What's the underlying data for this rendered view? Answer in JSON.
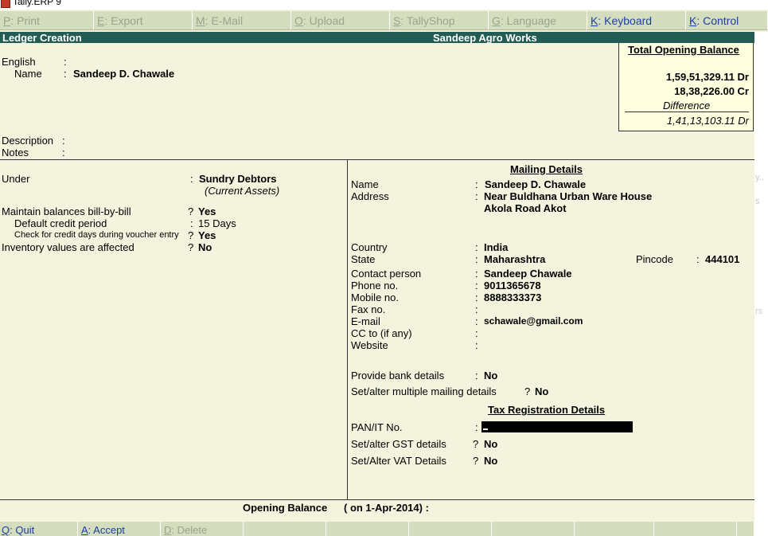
{
  "window": {
    "title": "Tally.ERP 9"
  },
  "menubar": [
    {
      "key": "P",
      "label": ": Print",
      "active": false
    },
    {
      "key": "E",
      "label": ": Export",
      "active": false
    },
    {
      "key": "M",
      "label": ": E-Mail",
      "active": false
    },
    {
      "key": "O",
      "label": ": Upload",
      "active": false
    },
    {
      "key": "S",
      "label": ": TallyShop",
      "active": false
    },
    {
      "key": "G",
      "label": ": Language",
      "active": false
    },
    {
      "key": "K",
      "label": ": Keyboard",
      "active": true
    },
    {
      "key": "K",
      "label": ": Control Centre",
      "active": true
    }
  ],
  "header": {
    "screen_title": "Ledger Creation",
    "company": "Sandeep Agro Works"
  },
  "name_section": {
    "english_label": "English",
    "name_label": "Name",
    "sep": ":",
    "name_value": "Sandeep D. Chawale",
    "description_label": "Description",
    "notes_label": "Notes"
  },
  "opening_balance_box": {
    "title": "Total Opening Balance",
    "dr_value": "1,59,51,329.11 Dr",
    "cr_value": "18,38,226.00 Cr",
    "difference_label": "Difference",
    "difference_value": "1,41,13,103.11 Dr"
  },
  "left_panel": {
    "under_label": "Under",
    "under_value": "Sundry Debtors",
    "under_group": "(Current Assets)",
    "bill_by_bill_label": "Maintain balances bill-by-bill",
    "bill_by_bill_value": "Yes",
    "credit_period_label": "Default credit period",
    "credit_period_value": "15 Days",
    "check_credit_label": "Check for credit days during voucher entry",
    "check_credit_value": "Yes",
    "inventory_label": "Inventory values are affected",
    "inventory_value": "No",
    "q": "?"
  },
  "mailing": {
    "heading": "Mailing Details",
    "name_label": "Name",
    "name_value": "Sandeep D. Chawale",
    "address_label": "Address",
    "address_line1": "Near Buldhana Urban Ware House",
    "address_line2": "Akola Road Akot",
    "country_label": "Country",
    "country_value": "India",
    "state_label": "State",
    "state_value": "Maharashtra",
    "pincode_label": "Pincode",
    "pincode_value": "444101",
    "contact_label": "Contact person",
    "contact_value": "Sandeep Chawale",
    "phone_label": "Phone no.",
    "phone_value": "9011365678",
    "mobile_label": "Mobile no.",
    "mobile_value": "8888333373",
    "fax_label": "Fax no.",
    "email_label": "E-mail",
    "email_value": "schawale@gmail.com",
    "cc_label": "CC to (if any)",
    "website_label": "Website",
    "bank_label": "Provide bank details",
    "bank_value": "No",
    "multi_mailing_label": "Set/alter multiple mailing details",
    "multi_mailing_value": "No"
  },
  "tax": {
    "heading": "Tax Registration Details",
    "pan_label": "PAN/IT No.",
    "gst_label": "Set/alter GST details",
    "gst_value": "No",
    "vat_label": "Set/Alter VAT Details",
    "vat_value": "No"
  },
  "opening_balance": {
    "label": "Opening Balance",
    "date_text": "( on 1-Apr-2014) :"
  },
  "footer": [
    {
      "key": "Q",
      "label": ": Quit",
      "active": true
    },
    {
      "key": "A",
      "label": ": Accept",
      "active": true
    },
    {
      "key": "D",
      "label": ": Delete",
      "active": false
    }
  ],
  "faded_right": {
    "a": "y..",
    "b": "s",
    "c": "rs"
  }
}
